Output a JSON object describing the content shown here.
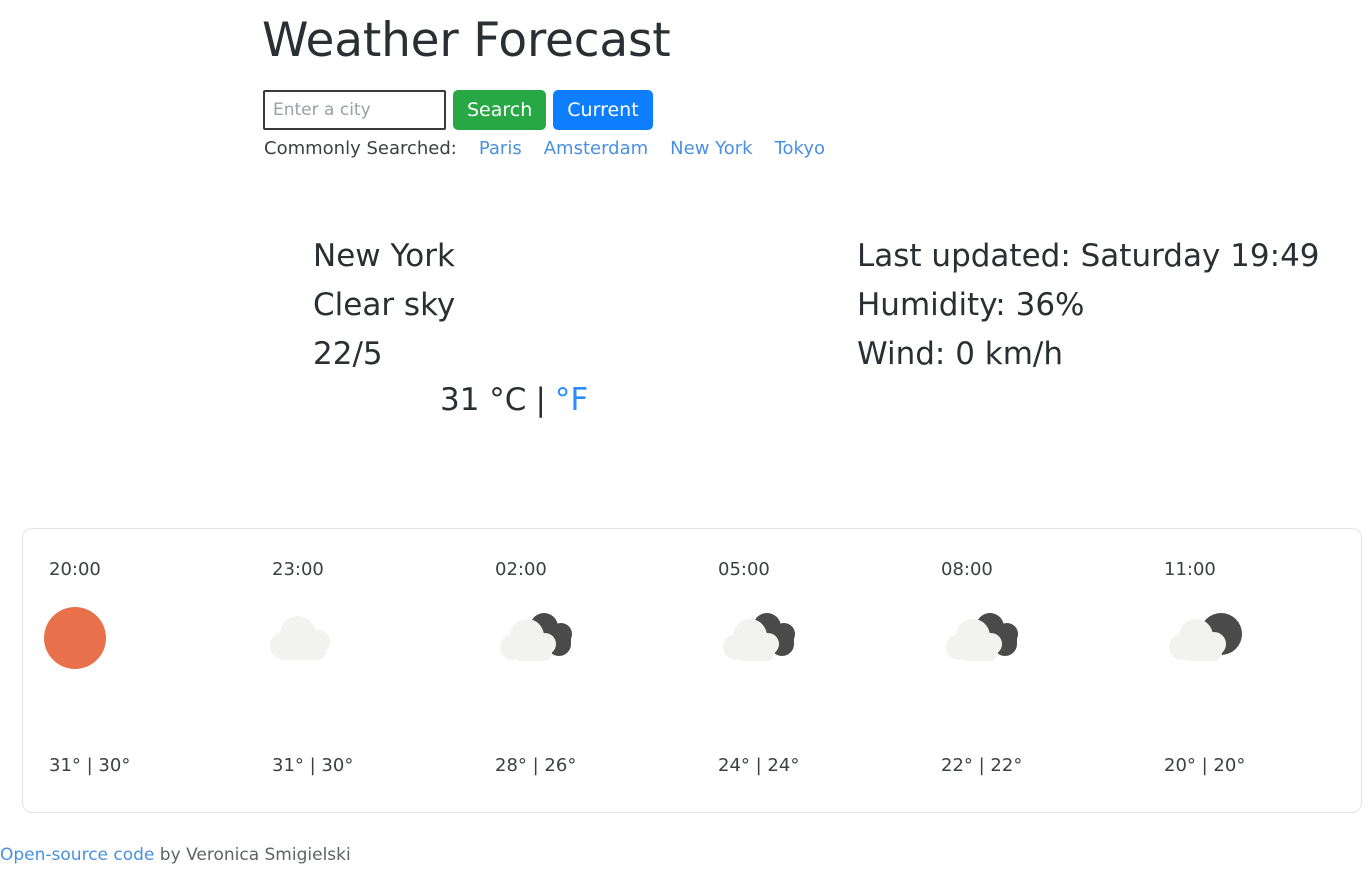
{
  "app": {
    "title": "Weather Forecast"
  },
  "search": {
    "input_value": "",
    "placeholder": "Enter a city",
    "search_label": "Search",
    "current_label": "Current",
    "commonly_searched_label": "Commonly Searched:",
    "cities": [
      "Paris",
      "Amsterdam",
      "New York",
      "Tokyo"
    ]
  },
  "current": {
    "city": "New York",
    "condition": "Clear sky",
    "date": "22/5",
    "temperature": "31 °C",
    "unit_separator": "|",
    "unit_alt": "°F",
    "icon": "sun-icon",
    "last_updated": "Last updated: Saturday 19:49",
    "humidity": "Humidity: 36%",
    "wind": "Wind: 0 km/h"
  },
  "forecast": {
    "hours": [
      {
        "time": "20:00",
        "icon": "sun-icon",
        "temps": "31° | 30°"
      },
      {
        "time": "23:00",
        "icon": "cloud-icon",
        "temps": "31° | 30°"
      },
      {
        "time": "02:00",
        "icon": "clouds-double-icon",
        "temps": "28° | 26°"
      },
      {
        "time": "05:00",
        "icon": "clouds-double-icon",
        "temps": "24° | 24°"
      },
      {
        "time": "08:00",
        "icon": "clouds-double-icon",
        "temps": "22° | 22°"
      },
      {
        "time": "11:00",
        "icon": "cloud-moon-icon",
        "temps": "20° | 20°"
      }
    ]
  },
  "footer": {
    "link_label": "Open-source code",
    "byline": " by Veronica Smigielski"
  },
  "colors": {
    "sun": "#e8704a",
    "cloud_light": "#f2f2f0",
    "cloud_dark": "#4a4a4a",
    "search_button": "#28a745",
    "current_button": "#0d7eff",
    "link": "#4a90e2",
    "unit_active_link": "#2b8cff",
    "card_border": "#e3e3e3"
  }
}
